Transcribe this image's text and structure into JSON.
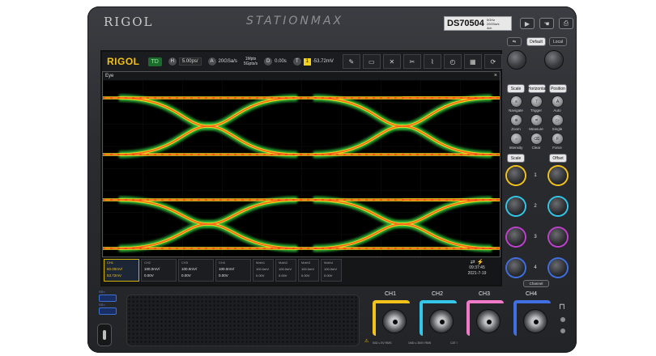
{
  "device": {
    "brand": "RIGOL",
    "series": "STATIONMAX",
    "model": "DS70504",
    "model_spec_line1": "5GHz",
    "model_spec_line2": "20GSa/s",
    "model_spec_line3": "4ch",
    "input_warning_1": "50Ω ≤ 5V RMS",
    "input_warning_2": "1MΩ ≤ 300V RMS",
    "input_cat": "CAT I"
  },
  "panel_buttons": {
    "top_row": [
      "",
      "",
      ""
    ],
    "default_label": "Default",
    "local_label": "Local",
    "scale_label": "Scale",
    "horizontal_label": "Horizontal",
    "position_label": "Position",
    "navigate_label": "Navigate",
    "trigger_label": "Trigger",
    "auto_label": "Auto",
    "zoom_label": "Zoom",
    "measure_label": "Measure",
    "single_label": "Single",
    "intensity_label": "Intensity",
    "clear_label": "Clear",
    "force_label": "Force",
    "scale2_label": "Scale",
    "offset_label": "Offset",
    "channel_numbers": [
      "1",
      "2",
      "3",
      "4"
    ],
    "channel_label": "Channel"
  },
  "toolbar": {
    "logo": "RIGOL",
    "run_state": "TD",
    "h_icon": "H",
    "timebase": "5.00ps/",
    "a_icon": "A",
    "sample_rate": "20GSa/s",
    "mem_line1": "1Mpts",
    "mem_line2": "5Gpts/s",
    "d_icon": "D",
    "delay": "0.00s",
    "t_icon": "T",
    "trig_ch": "1",
    "trig_level": "-53.72mV",
    "tool_icons": [
      "pen",
      "ruler",
      "swap",
      "scissors",
      "waveform",
      "history",
      "grid",
      "refresh"
    ]
  },
  "eye_window": {
    "title": "Eye",
    "close": "×"
  },
  "channels": [
    {
      "label": "CH1",
      "scale": "60.00mV/",
      "offset": "53.72mV",
      "active": true
    },
    {
      "label": "CH2",
      "scale": "100.0mV/",
      "offset": "0.00V",
      "active": false
    },
    {
      "label": "CH3",
      "scale": "100.0mV/",
      "offset": "0.00V",
      "active": false
    },
    {
      "label": "CH4",
      "scale": "100.0mV/",
      "offset": "0.00V",
      "active": false
    }
  ],
  "math": [
    {
      "label": "Math1",
      "line1": "100.0mV",
      "line2": "0.00V"
    },
    {
      "label": "Math2",
      "line1": "100.0mV",
      "line2": "0.00V"
    },
    {
      "label": "Math3",
      "line1": "100.0mV",
      "line2": "0.00V"
    },
    {
      "label": "Math4",
      "line1": "100.0mV",
      "line2": "0.00V"
    }
  ],
  "status": {
    "time": "09:37:45",
    "date": "2021-7-19"
  },
  "bottom_inputs": {
    "labels": [
      "CH1",
      "CH2",
      "CH3",
      "CH4"
    ],
    "colors": [
      "#f2c21a",
      "#33c6e8",
      "#f07ac8",
      "#3f6fe0"
    ]
  },
  "usb": {
    "label": "SS<"
  }
}
